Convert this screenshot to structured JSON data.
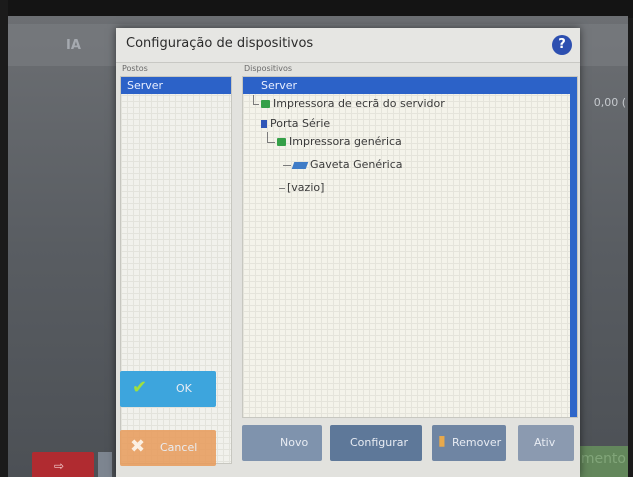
{
  "background": {
    "left_text": "IA",
    "right_text": "0,00 (",
    "bottom_right_text": "mento"
  },
  "dialog": {
    "title": "Configuração de dispositivos",
    "help_icon": "?"
  },
  "postos": {
    "label": "Postos",
    "items": [
      "Server"
    ]
  },
  "dispositivos": {
    "label": "Dispositivos",
    "root": "Server",
    "tree": [
      {
        "label": "Impressora de ecrã do servidor",
        "icon": "printer-icon"
      },
      {
        "label": "Porta Série",
        "icon": "serial-port-icon"
      },
      {
        "label": "Impressora genérica",
        "icon": "printer-icon"
      },
      {
        "label": "Gaveta Genérica",
        "icon": "cash-drawer-icon"
      },
      {
        "label": "[vazio]",
        "icon": ""
      }
    ]
  },
  "buttons": {
    "ok": "OK",
    "cancel": "Cancel",
    "novo": "Novo",
    "configurar": "Configurar",
    "remover": "Remover",
    "ativ": "Ativ"
  },
  "colors": {
    "selection": "#2c62c8",
    "ok_button": "#3da5dd",
    "cancel_button": "#e89b5a",
    "help_button": "#2d4fb0"
  }
}
